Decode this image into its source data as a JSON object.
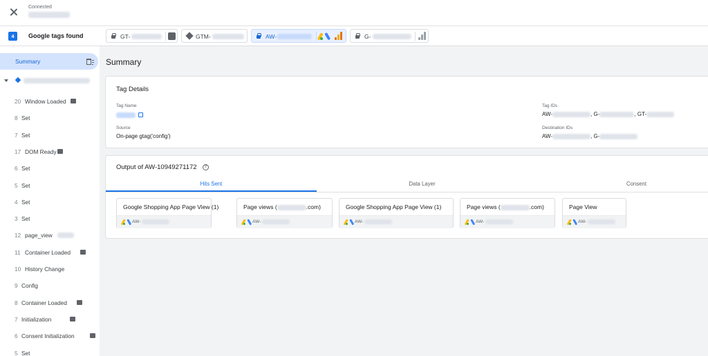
{
  "header": {
    "status_label": "Connected",
    "close_icon": "close-icon"
  },
  "tags_bar": {
    "count": "4",
    "label": "Google tags found",
    "chips": [
      {
        "prefix": "GT-",
        "icon": "lock-icon",
        "trailing_icon": "container-icon",
        "active": false
      },
      {
        "prefix": "GTM-",
        "icon": "gtm-diamond-icon",
        "active": false
      },
      {
        "prefix": "AW-",
        "icon": "lock-icon",
        "trailing_icons": [
          "google-ads-icon",
          "google-analytics-icon"
        ],
        "active": true
      },
      {
        "prefix": "G-",
        "icon": "lock-icon",
        "trailing_icon": "google-analytics-icon",
        "active": false
      }
    ]
  },
  "sidebar": {
    "summary_label": "Summary",
    "events": [
      {
        "num": "20",
        "name": "Window Loaded",
        "badge": true
      },
      {
        "num": "8",
        "name": "Set"
      },
      {
        "num": "7",
        "name": "Set"
      },
      {
        "num": "17",
        "name": "DOM Ready",
        "badge": true
      },
      {
        "num": "6",
        "name": "Set"
      },
      {
        "num": "5",
        "name": "Set"
      },
      {
        "num": "4",
        "name": "Set"
      },
      {
        "num": "3",
        "name": "Set"
      },
      {
        "num": "12",
        "name": "page_view"
      },
      {
        "num": "11",
        "name": "Container Loaded",
        "badge": true
      },
      {
        "num": "10",
        "name": "History Change"
      },
      {
        "num": "9",
        "name": "Config"
      },
      {
        "num": "8",
        "name": "Container Loaded",
        "badge": true
      },
      {
        "num": "7",
        "name": "Initialization",
        "badge": true
      },
      {
        "num": "6",
        "name": "Consent Initialization",
        "badge": true
      },
      {
        "num": "5",
        "name": "Set"
      }
    ]
  },
  "main": {
    "title": "Summary",
    "tag_details": {
      "title": "Tag Details",
      "tag_name_label": "Tag Name",
      "source_label": "Source",
      "source_value": "On-page gtag('config')",
      "tag_ids_label": "Tag IDs",
      "tag_ids_parts": [
        "AW-",
        ", G-",
        ", GT-"
      ],
      "destination_ids_label": "Destination IDs",
      "destination_ids_parts": [
        "AW-",
        ", G-"
      ]
    },
    "output": {
      "title": "Output of AW-10949271172",
      "tabs": [
        "Hits Sent",
        "Data Layer",
        "Consent"
      ],
      "active_tab": "Hits Sent",
      "hits": [
        {
          "title": "Google Shopping App Page View (1)",
          "id_prefix": "AW-"
        },
        {
          "title_pre": "Page views (",
          "title_post": ".com)",
          "id_prefix": "AW-"
        },
        {
          "title": "Google Shopping App Page View (1)",
          "id_prefix": "AW-"
        },
        {
          "title_pre": "Page views (",
          "title_post": ".com)",
          "id_prefix": "AW-"
        },
        {
          "title": "Page View",
          "id_prefix": "AW-"
        }
      ]
    }
  }
}
